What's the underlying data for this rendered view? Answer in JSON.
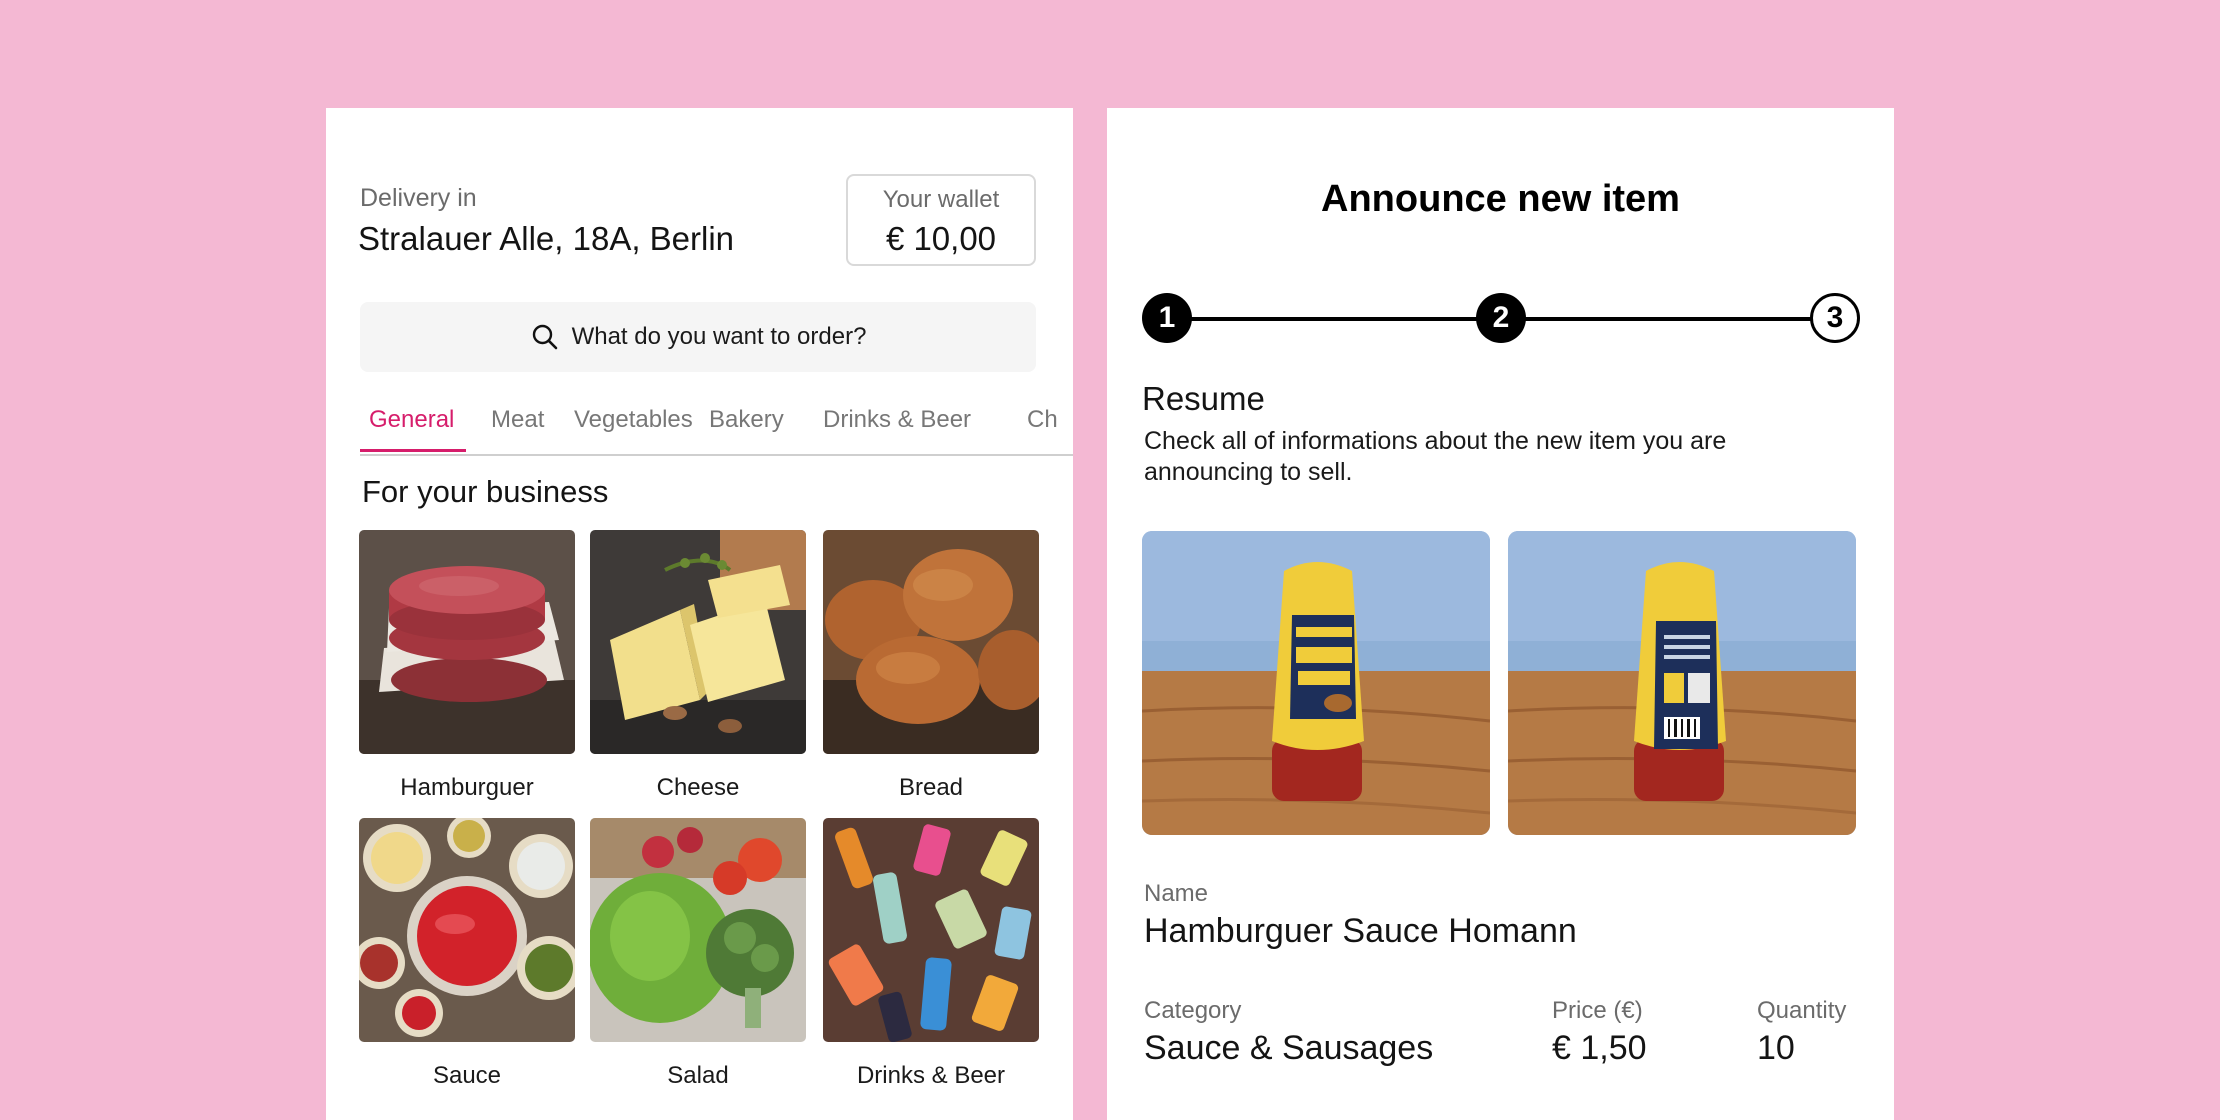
{
  "delivery": {
    "label": "Delivery in",
    "address": "Stralauer Alle, 18A, Berlin"
  },
  "wallet": {
    "label": "Your wallet",
    "value": "€ 10,00"
  },
  "search": {
    "placeholder": "What do you want to order?",
    "icon": "search-icon"
  },
  "tabs": [
    {
      "label": "General",
      "active": true
    },
    {
      "label": "Meat"
    },
    {
      "label": "Vegetables"
    },
    {
      "label": "Bakery"
    },
    {
      "label": "Drinks & Beer"
    },
    {
      "label": "Ch"
    }
  ],
  "section_title": "For your business",
  "products": [
    {
      "label": "Hamburguer"
    },
    {
      "label": "Cheese"
    },
    {
      "label": "Bread"
    },
    {
      "label": "Sauce"
    },
    {
      "label": "Salad"
    },
    {
      "label": "Drinks & Beer"
    }
  ],
  "announce": {
    "title": "Announce new item",
    "steps": [
      "1",
      "2",
      "3"
    ],
    "current_step": 2,
    "resume_title": "Resume",
    "resume_desc": "Check all of informations about the new item you are announcing to sell.",
    "name_label": "Name",
    "name_value": "Hamburguer Sauce Homann",
    "category_label": "Category",
    "category_value": "Sauce & Sausages",
    "price_label": "Price (€)",
    "price_value": "€ 1,50",
    "quantity_label": "Quantity",
    "quantity_value": "10"
  },
  "colors": {
    "background": "#f4b8d3",
    "accent": "#d61d6b",
    "card": "#ffffff"
  }
}
